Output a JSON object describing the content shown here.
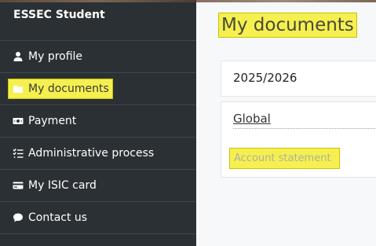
{
  "sidebar": {
    "brand": "ESSEC Student",
    "items": [
      {
        "label": "My profile",
        "icon": "user-icon",
        "active": false
      },
      {
        "label": "My documents",
        "icon": "folder-icon",
        "active": true
      },
      {
        "label": "Payment",
        "icon": "cash-icon",
        "active": false
      },
      {
        "label": "Administrative process",
        "icon": "checklist-icon",
        "active": false
      },
      {
        "label": "My ISIC card",
        "icon": "credit-card-icon",
        "active": false
      },
      {
        "label": "Contact us",
        "icon": "chat-icon",
        "active": false
      }
    ]
  },
  "main": {
    "title": "My documents",
    "year": "2025/2026",
    "tab": "Global",
    "document_link": "Account statement"
  },
  "colors": {
    "sidebar_bg": "#2b3035",
    "highlight": "#f5f050",
    "main_bg": "#f7f8f9"
  }
}
